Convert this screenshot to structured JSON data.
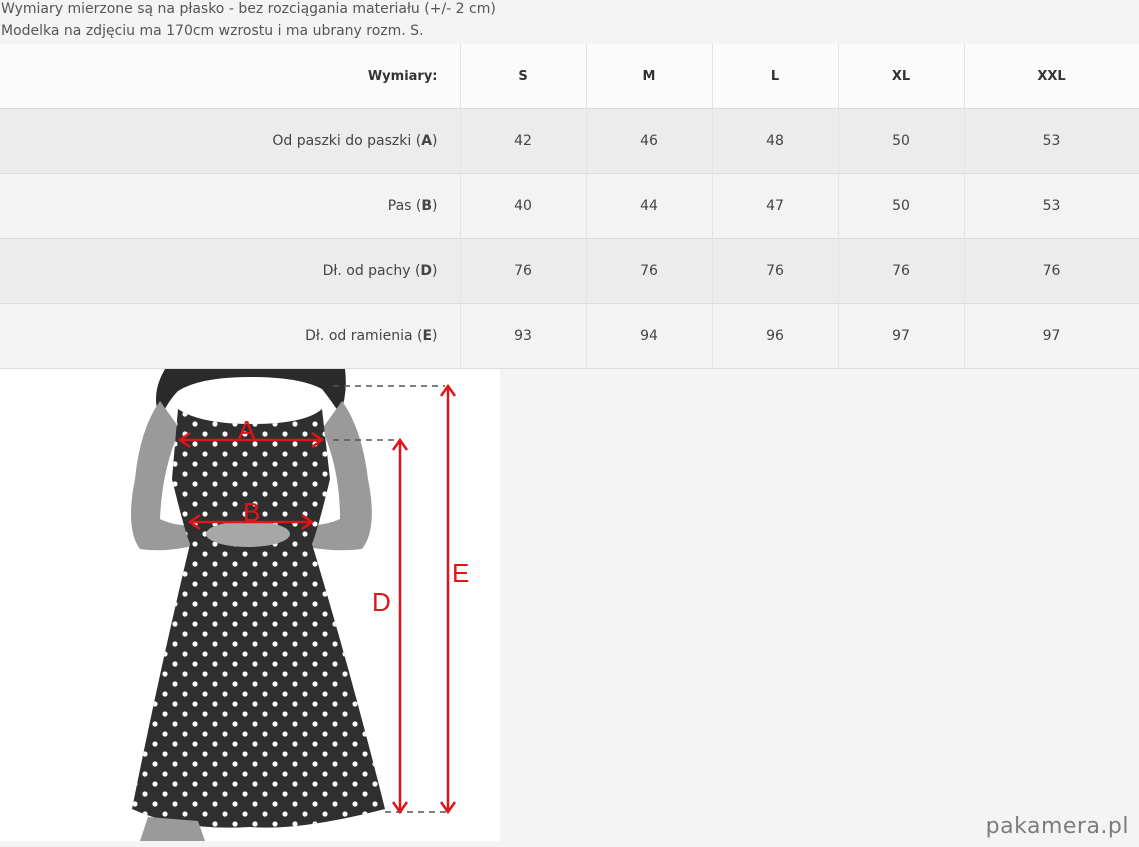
{
  "notes": {
    "line1": "Wymiary mierzone są na płasko - bez rozciągania materiału (+/- 2 cm)",
    "line2": "Modelka na zdjęciu ma 170cm wzrostu i ma ubrany rozm. S."
  },
  "table": {
    "header_label": "Wymiary:",
    "sizes": [
      "S",
      "M",
      "L",
      "XL",
      "XXL"
    ],
    "rows": [
      {
        "label": "Od paszki do paszki (",
        "letter": "A",
        "close": ")",
        "values": [
          "42",
          "46",
          "48",
          "50",
          "53"
        ]
      },
      {
        "label": "Pas (",
        "letter": "B",
        "close": ")",
        "values": [
          "40",
          "44",
          "47",
          "50",
          "53"
        ]
      },
      {
        "label": "Dł. od pachy (",
        "letter": "D",
        "close": ")",
        "values": [
          "76",
          "76",
          "76",
          "76",
          "76"
        ]
      },
      {
        "label": "Dł. od ramienia (",
        "letter": "E",
        "close": ")",
        "values": [
          "93",
          "94",
          "96",
          "97",
          "97"
        ]
      }
    ]
  },
  "figure": {
    "labels": {
      "a": "A",
      "b": "B",
      "d": "D",
      "e": "E"
    },
    "colors": {
      "arrow": "#e0141b",
      "dress": "#2f2f2f",
      "skin": "#9a9a9a",
      "hair": "#2a2a2a",
      "dashed": "#555555"
    }
  },
  "watermark": "pakamera.pl"
}
